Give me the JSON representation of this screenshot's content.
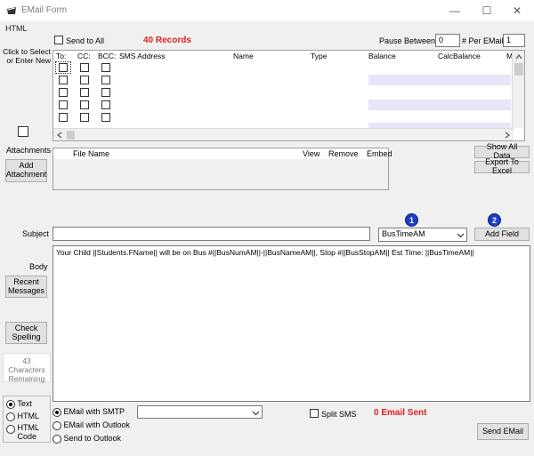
{
  "window": {
    "title": "EMail Form",
    "minimize": "—",
    "maximize": "☐",
    "close": "✕"
  },
  "menu": {
    "html": "HTML"
  },
  "top": {
    "send_to_all": "Send to All",
    "records": "40 Records",
    "pause_between_label": "Pause Between",
    "pause_between_value": "0",
    "per_email_label": "# Per EMail",
    "per_email_value": "1"
  },
  "left": {
    "click_to_select": "Click to Select or Enter New",
    "attachments_label": "Attachments",
    "add_attachment": "Add Attachment",
    "subject_label": "Subject",
    "body_label": "Body",
    "recent_messages": "Recent Messages",
    "check_spelling": "Check Spelling",
    "chars_remaining": "43 Characters Remaining"
  },
  "grid": {
    "columns": [
      "To:",
      "CC:",
      "BCC:",
      "SMS Address",
      "Name",
      "Type",
      "Balance",
      "CalcBalance",
      "M"
    ]
  },
  "attachments": {
    "columns": [
      "File Name",
      "View",
      "Remove",
      "Embed"
    ]
  },
  "right": {
    "show_all_data": "Show All Data",
    "export_to_excel": "Export To Excel"
  },
  "subject": {
    "value": "",
    "field_select": "BusTimeAM",
    "add_field": "Add Field",
    "badge1": "1",
    "badge2": "2"
  },
  "body": {
    "text": "Your Child ||Students.FName|| will be on Bus #||BusNumAM||-||BusNameAM||, Stop #||BusStopAM|| Est Time: ||BusTimeAM||"
  },
  "format": {
    "text": "Text",
    "html": "HTML",
    "html_code": "HTML Code"
  },
  "send_method": {
    "smtp": "EMail with SMTP",
    "outlook": "EMail with Outlook",
    "send_outlook": "Send to Outlook",
    "split_sms": "Split SMS",
    "sent_count": "0 Email Sent",
    "send_email": "Send EMail"
  }
}
